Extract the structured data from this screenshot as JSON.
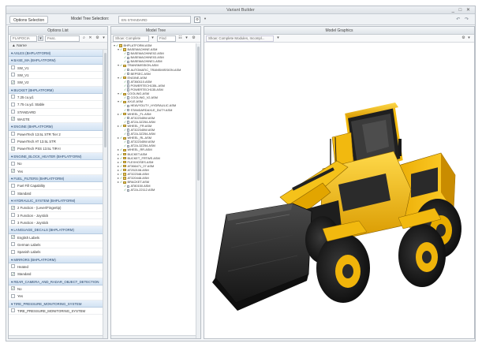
{
  "window": {
    "title": "Variant Builder",
    "controls": "_ □ ✕"
  },
  "toolbar": {
    "option_selection": "Options Selection",
    "model_tree_selection_label": "Model Tree Selection:",
    "model_tree_selection_value": "EN STANDARD",
    "undo_redo": "↶ ↷"
  },
  "panels": {
    "options_list": "Options List",
    "model_tree": "Model Tree",
    "model_graphics": "Model Graphics"
  },
  "options": {
    "filter_value": "FLAPOCIA",
    "search_placeholder": "Feat..",
    "column_name": "Name",
    "rows": [
      {
        "type": "h",
        "label": "AXLES (BHPLATFORM)"
      },
      {
        "type": "h",
        "label": "BASE_MA (BHPLATFORM)"
      },
      {
        "type": "o",
        "label": "SW_V1",
        "checked": false
      },
      {
        "type": "o",
        "label": "SW_V1",
        "checked": false
      },
      {
        "type": "o",
        "label": "SW_V2",
        "checked": true
      },
      {
        "type": "h",
        "label": "BUCKET (BHPLATFORM)"
      },
      {
        "type": "o",
        "label": "7.25 cu.yd.",
        "checked": false
      },
      {
        "type": "o",
        "label": "7.75 cu.yd. Stable",
        "checked": false
      },
      {
        "type": "o",
        "label": "STANDARD",
        "checked": false
      },
      {
        "type": "o",
        "label": "WAGTE",
        "checked": true
      },
      {
        "type": "h",
        "label": "ENGINE (BHPLATFORM)"
      },
      {
        "type": "o",
        "label": "PowerTech 13.5L STR Tier 2",
        "checked": false
      },
      {
        "type": "o",
        "label": "PowerTech AT 13.5L STR",
        "checked": false
      },
      {
        "type": "o",
        "label": "PowerTech PSS 13.5L TIR-II",
        "checked": true
      },
      {
        "type": "h",
        "label": "ENGINE_BLOCK_HEATER (BHPLATFORM)"
      },
      {
        "type": "o",
        "label": "No",
        "checked": false
      },
      {
        "type": "o",
        "label": "Yes",
        "checked": true
      },
      {
        "type": "h",
        "label": "FUEL_FILTERS (BHPLATFORM)"
      },
      {
        "type": "o",
        "label": "Fuel Fill Capability",
        "checked": false
      },
      {
        "type": "o",
        "label": "Standard",
        "checked": false
      },
      {
        "type": "h",
        "label": "HYDRAULIC_SYSTEM (BHPLATFORM)"
      },
      {
        "type": "o",
        "label": "2 Function - (Lever/Fingertip)",
        "checked": true
      },
      {
        "type": "o",
        "label": "3 Function - Joystick",
        "checked": false
      },
      {
        "type": "o",
        "label": "3 Function - Joystick",
        "checked": false
      },
      {
        "type": "h",
        "label": "LANGUAGE_DECALS (BHPLATFORM)"
      },
      {
        "type": "o",
        "label": "English Labels",
        "checked": true
      },
      {
        "type": "o",
        "label": "German Labels",
        "checked": false
      },
      {
        "type": "o",
        "label": "Spanish Labels",
        "checked": false
      },
      {
        "type": "h",
        "label": "MIRRORS (BHPLATFORM)"
      },
      {
        "type": "o",
        "label": "Heated",
        "checked": false
      },
      {
        "type": "o",
        "label": "Standard",
        "checked": true
      },
      {
        "type": "h",
        "label": "REAR_CAMERA_AND_RADAR_OBJECT_DETECTION"
      },
      {
        "type": "o",
        "label": "No",
        "checked": true
      },
      {
        "type": "o",
        "label": "Yes",
        "checked": false
      },
      {
        "type": "h",
        "label": "TIRE_PRESSURE_MONITORING_SYSTEM"
      },
      {
        "type": "o",
        "label": "TIRE_PRESSURE_MONITORING_SYSTEM",
        "checked": false
      }
    ]
  },
  "tree": {
    "show_label": "Show: Complete",
    "find_label": "Find",
    "nodes": [
      {
        "d": 0,
        "ex": "−",
        "t": "f",
        "label": "BHPLATFORM.ASM"
      },
      {
        "d": 1,
        "ex": "−",
        "t": "f",
        "label": "BASEMACHINE.ASM"
      },
      {
        "d": 2,
        "ex": "",
        "t": "p",
        "label": "BASEMACHINE02.ASM"
      },
      {
        "d": 2,
        "ex": "",
        "t": "p",
        "label": "BASEMACHINE03.ASM"
      },
      {
        "d": 2,
        "ex": "",
        "t": "p",
        "label": "BASEMACHINE1.ASM"
      },
      {
        "d": 1,
        "ex": "−",
        "t": "f",
        "label": "TRANSMISSION.ASM"
      },
      {
        "d": 2,
        "ex": "",
        "t": "p",
        "label": "AUTOMATIC_TRANSMISSION.ASM"
      },
      {
        "d": 2,
        "ex": "",
        "t": "p",
        "label": "BEPSEC.ASM"
      },
      {
        "d": 1,
        "ex": "−",
        "t": "f",
        "label": "ENGINE.ASM"
      },
      {
        "d": 2,
        "ex": "",
        "t": "p",
        "label": "AT360110.ASM"
      },
      {
        "d": 2,
        "ex": "",
        "t": "p",
        "label": "POWERTECH135L.ASM"
      },
      {
        "d": 2,
        "ex": "",
        "t": "p",
        "label": "POWERTECH135.ASM"
      },
      {
        "d": 1,
        "ex": "−",
        "t": "f",
        "label": "COOLING.ASM"
      },
      {
        "d": 2,
        "ex": "",
        "t": "p",
        "label": "COOLING_V2.ASM"
      },
      {
        "d": 1,
        "ex": "−",
        "t": "f",
        "label": "AXLE.ASM"
      },
      {
        "d": 2,
        "ex": "",
        "t": "p",
        "label": "HEAVYDUTY_HYDRAULIC.ASM"
      },
      {
        "d": 2,
        "ex": "",
        "t": "p",
        "label": "STANDARDAXLE_DUTY.ASM"
      },
      {
        "d": 1,
        "ex": "+",
        "t": "f",
        "label": "WHEEL_FL.ASM"
      },
      {
        "d": 2,
        "ex": "",
        "t": "p",
        "label": "AT322345W.ASM"
      },
      {
        "d": 2,
        "ex": "",
        "t": "p",
        "label": "AT2A-3Z254.ASM"
      },
      {
        "d": 1,
        "ex": "+",
        "t": "f",
        "label": "WHEEL_FR.ASM"
      },
      {
        "d": 2,
        "ex": "",
        "t": "p",
        "label": "AT322345W.ASM"
      },
      {
        "d": 2,
        "ex": "",
        "t": "p",
        "label": "AT2A-3Z254.ASM"
      },
      {
        "d": 1,
        "ex": "+",
        "t": "f",
        "label": "WHEEL_RL.ASM"
      },
      {
        "d": 2,
        "ex": "",
        "t": "p",
        "label": "AT322345W.ASM"
      },
      {
        "d": 2,
        "ex": "",
        "t": "p",
        "label": "AT2A-3Z254.ASM"
      },
      {
        "d": 1,
        "ex": "+",
        "t": "f",
        "label": "WHEEL_RR.ASM"
      },
      {
        "d": 1,
        "ex": "+",
        "t": "f",
        "label": "BUCKET.ASM"
      },
      {
        "d": 1,
        "ex": "+",
        "t": "f",
        "label": "BUCKET_FRTWE.ASM"
      },
      {
        "d": 1,
        "ex": "+",
        "t": "f",
        "label": "FLEXHOSES.ASM"
      },
      {
        "d": 1,
        "ex": "+",
        "t": "f",
        "label": "AT366471_07.ASM"
      },
      {
        "d": 1,
        "ex": "+",
        "t": "f",
        "label": "AT252108.ASM"
      },
      {
        "d": 1,
        "ex": "+",
        "t": "f",
        "label": "AT322348.ASM"
      },
      {
        "d": 1,
        "ex": "+",
        "t": "f",
        "label": "AT320448.ASM"
      },
      {
        "d": 1,
        "ex": "+",
        "t": "f",
        "label": "BRACKET.ASM"
      },
      {
        "d": 2,
        "ex": "",
        "t": "p",
        "label": "AT80150.ASM"
      },
      {
        "d": 2,
        "ex": "",
        "t": "p",
        "label": "AT2A-22112.ASM"
      }
    ]
  },
  "graphics": {
    "show_label": "Show: Complete Modules, Incompl..."
  },
  "colors": {
    "machine": "#f2b90f",
    "dark": "#1b1b1b",
    "header_blue": "#d3e3f3"
  }
}
